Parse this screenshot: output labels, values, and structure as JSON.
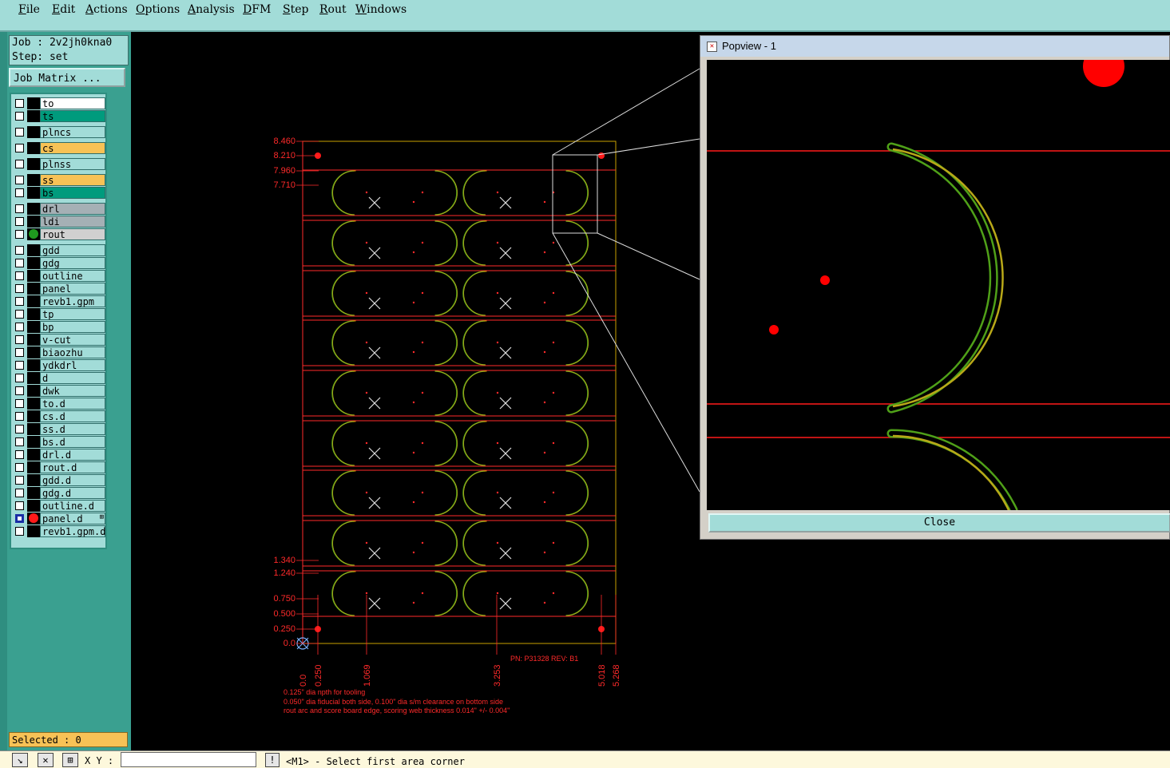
{
  "menu": [
    "File",
    "Edit",
    "Actions",
    "Options",
    "Analysis",
    "DFM",
    "Step",
    "Rout",
    "Windows"
  ],
  "job": {
    "job_line": "Job : 2v2jh0kna0",
    "step_line": "Step: set"
  },
  "job_matrix_label": "Job Matrix ...",
  "layers": [
    {
      "name": "to",
      "bg": "#ffffff"
    },
    {
      "name": "ts",
      "bg": "#009b7d"
    },
    {
      "name": "plncs",
      "bg": "#a2dcd8"
    },
    {
      "name": "cs",
      "bg": "#f7c256"
    },
    {
      "name": "plnss",
      "bg": "#a2dcd8"
    },
    {
      "name": "ss",
      "bg": "#f7c256"
    },
    {
      "name": "bs",
      "bg": "#009b7d"
    },
    {
      "name": "drl",
      "bg": "#a5b0b5"
    },
    {
      "name": "ldi",
      "bg": "#a5b0b5"
    },
    {
      "name": "rout",
      "bg": "#d0d0d0",
      "dot": "#1f9a1f"
    },
    {
      "name": "gdd",
      "bg": "#a2dcd8"
    },
    {
      "name": "gdg",
      "bg": "#a2dcd8"
    },
    {
      "name": "outline",
      "bg": "#a2dcd8"
    },
    {
      "name": "panel",
      "bg": "#a2dcd8"
    },
    {
      "name": "revb1.gpm",
      "bg": "#a2dcd8"
    },
    {
      "name": "tp",
      "bg": "#a2dcd8"
    },
    {
      "name": "bp",
      "bg": "#a2dcd8"
    },
    {
      "name": "v-cut",
      "bg": "#a2dcd8"
    },
    {
      "name": "biaozhu",
      "bg": "#a2dcd8"
    },
    {
      "name": "ydkdrl",
      "bg": "#a2dcd8"
    },
    {
      "name": "d",
      "bg": "#a2dcd8"
    },
    {
      "name": "dwk",
      "bg": "#a2dcd8"
    },
    {
      "name": "to.d",
      "bg": "#a2dcd8"
    },
    {
      "name": "cs.d",
      "bg": "#a2dcd8"
    },
    {
      "name": "ss.d",
      "bg": "#a2dcd8"
    },
    {
      "name": "bs.d",
      "bg": "#a2dcd8"
    },
    {
      "name": "drl.d",
      "bg": "#a2dcd8"
    },
    {
      "name": "rout.d",
      "bg": "#a2dcd8"
    },
    {
      "name": "gdd.d",
      "bg": "#a2dcd8"
    },
    {
      "name": "gdg.d",
      "bg": "#a2dcd8"
    },
    {
      "name": "outline.d",
      "bg": "#a2dcd8"
    },
    {
      "name": "panel.d",
      "bg": "#a2dcd8",
      "dot": "#ff1a1a",
      "checked": true,
      "icon": "⊞"
    },
    {
      "name": "revb1.gpm.d",
      "bg": "#a2dcd8"
    }
  ],
  "selected_label": "Selected : 0",
  "status": {
    "xy_label": "X Y :",
    "xy_value": "",
    "message": "<M1> - Select first area corner"
  },
  "status_icons": [
    "select-arrow-icon",
    "cross-icon",
    "grid-icon"
  ],
  "canvas": {
    "y_labels": [
      "8.460",
      "8.210",
      "7.960",
      "7.710",
      "1.340",
      "1.240",
      "0.750",
      "0.500",
      "0.250",
      "0.0"
    ],
    "x_labels": [
      "0.0",
      "0.250",
      "1.069",
      "3.253",
      "5.018",
      "5.268"
    ],
    "pn_label": "PN: P31328 REV: B1",
    "notes": [
      "0.125\" dia npth for tooling",
      "0.050\" dia fiducial both side, 0.100\" dia s/m clearance on bottom side",
      "rout arc and score board edge, scoring web thickness 0.014\" +/- 0.004\""
    ]
  },
  "popview": {
    "title": "Popview - 1",
    "close_label": "Close"
  },
  "colors": {
    "accent": "#a2dcd8",
    "rout": "#6aa820",
    "dim": "#ff2a2a",
    "outline": "#c8a000"
  }
}
